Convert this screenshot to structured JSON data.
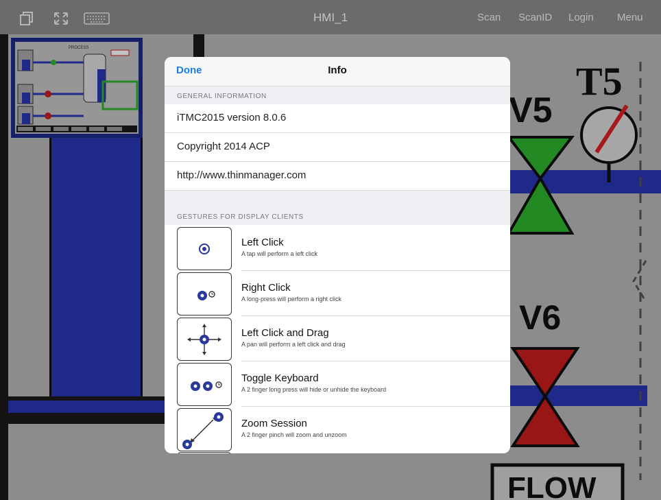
{
  "app": {
    "title": "HMI_1",
    "nav": {
      "scan": "Scan",
      "scan_id": "ScanID",
      "login": "Login",
      "menu": "Menu"
    },
    "icons": [
      "copy-icon",
      "fullscreen-icon",
      "keyboard-icon"
    ]
  },
  "hmi": {
    "labels": {
      "t5": "T5",
      "v5": "V5",
      "v6": "V6",
      "flow": "FLOW"
    },
    "thumbnail_label": "PROCESS",
    "colors": {
      "blue": "#2a36b4",
      "green": "#2fb52f",
      "red": "#c81e1e"
    }
  },
  "info": {
    "done": "Done",
    "title": "Info",
    "general_header": "GENERAL INFORMATION",
    "general_items": [
      "iTMC2015 version 8.0.6",
      "Copyright 2014 ACP",
      "http://www.thinmanager.com"
    ],
    "gestures_header": "GESTURES FOR DISPLAY CLIENTS",
    "gestures": [
      {
        "title": "Left Click",
        "desc": "A tap will perform a left click",
        "icon": "tap-gesture-icon"
      },
      {
        "title": "Right Click",
        "desc": "A long-press will perform a right click",
        "icon": "long-press-gesture-icon"
      },
      {
        "title": "Left Click and Drag",
        "desc": "A pan will perform a left click and drag",
        "icon": "pan-gesture-icon"
      },
      {
        "title": "Toggle Keyboard",
        "desc": "A 2 finger long press will hide or unhide the keyboard",
        "icon": "two-finger-long-press-icon"
      },
      {
        "title": "Zoom Session",
        "desc": "A 2 finger pinch will zoom and unzoom",
        "icon": "pinch-gesture-icon"
      }
    ]
  }
}
